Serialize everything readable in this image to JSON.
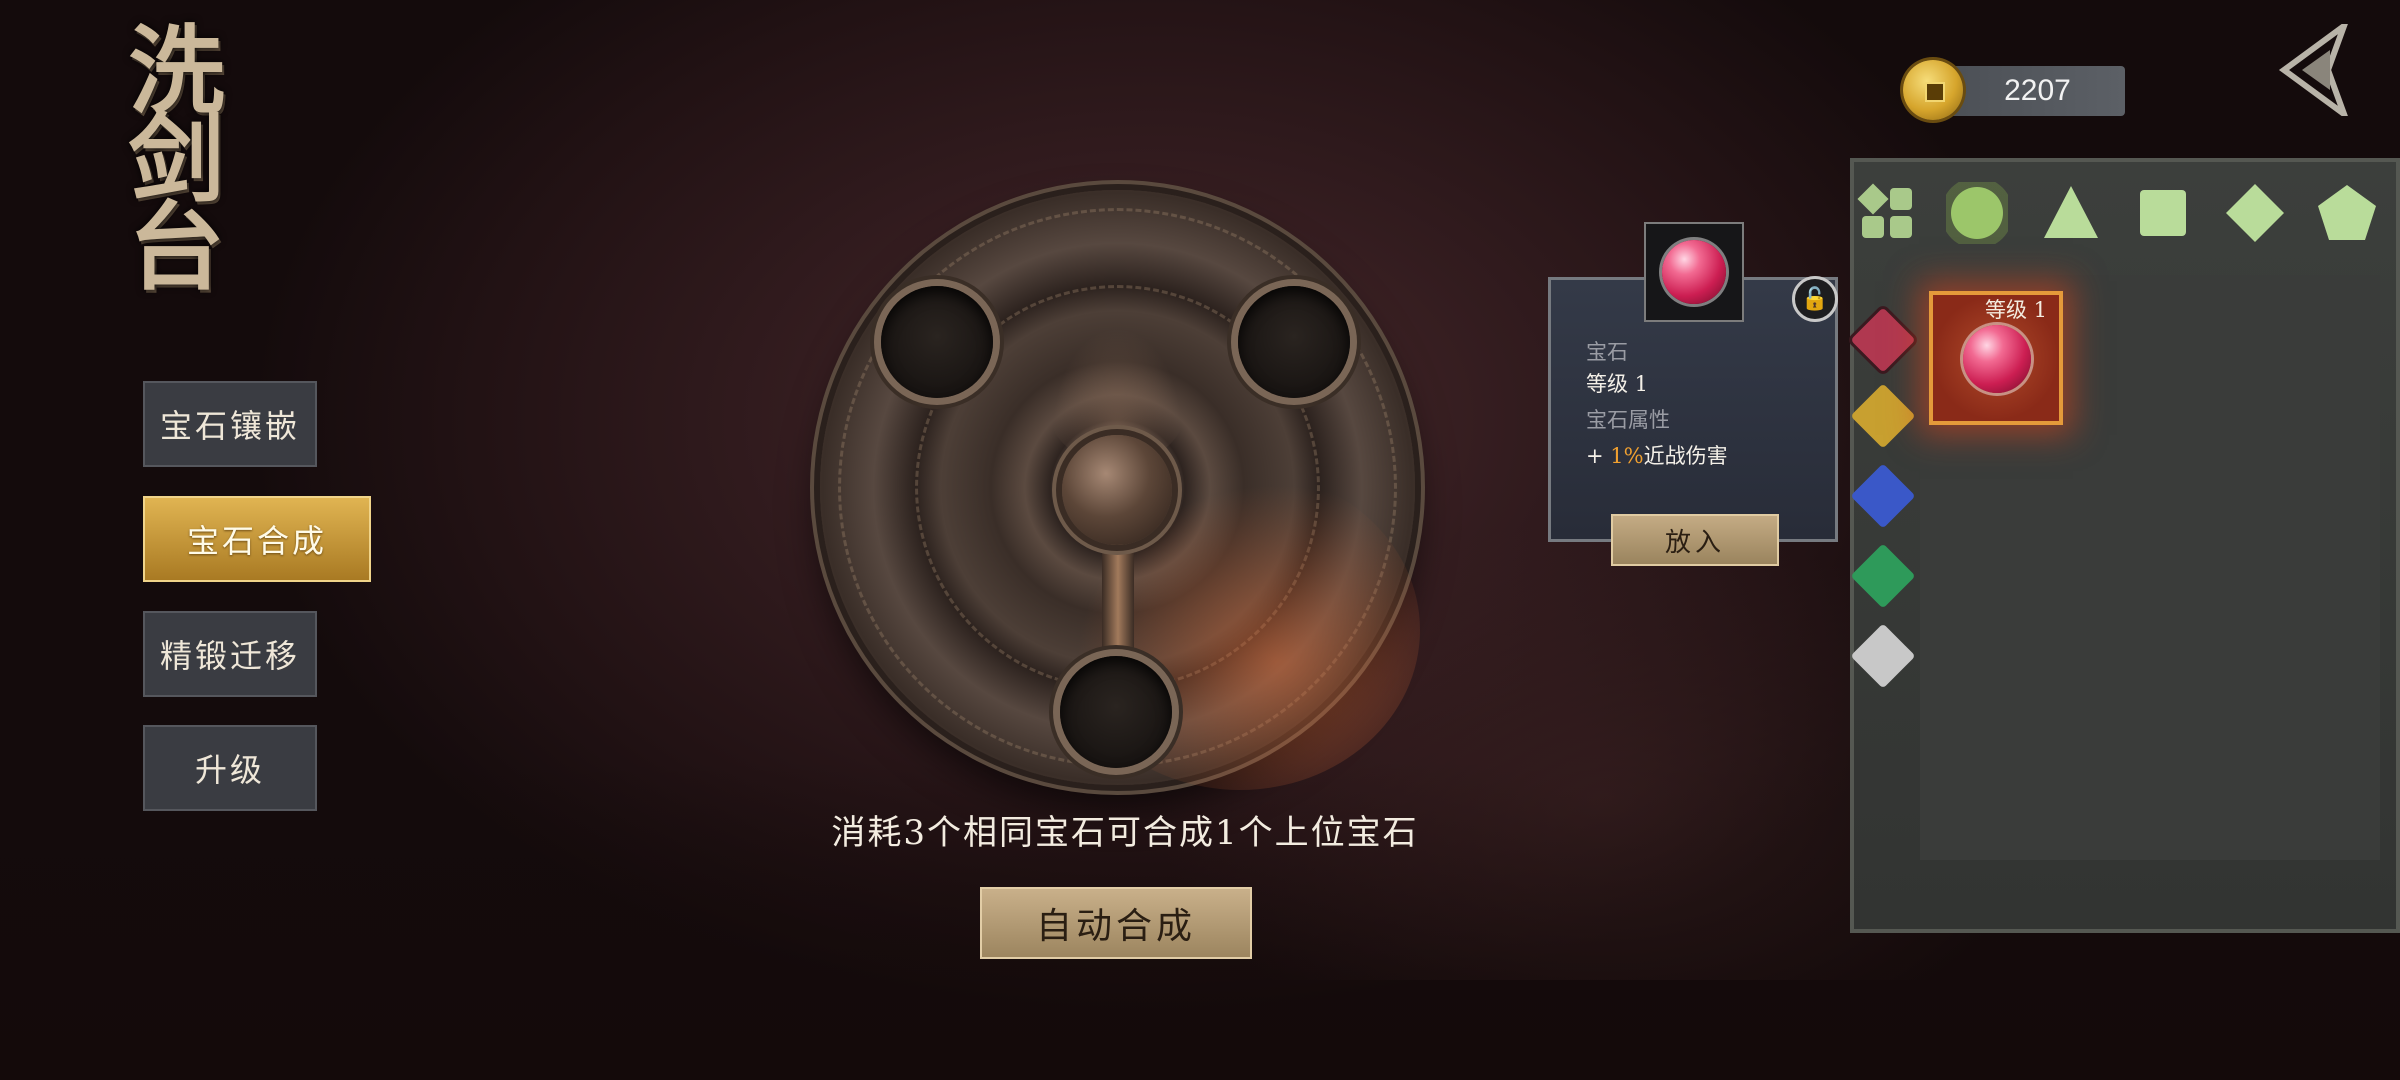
{
  "page": {
    "title": "洗剑台"
  },
  "menu": {
    "items": [
      {
        "label": "宝石镶嵌",
        "active": false
      },
      {
        "label": "宝石合成",
        "active": true
      },
      {
        "label": "精锻迁移",
        "active": false
      },
      {
        "label": "升级",
        "active": false
      }
    ]
  },
  "combine": {
    "info": "消耗3个相同宝石可合成1个上位宝石",
    "auto_button": "自动合成"
  },
  "currency": {
    "icon": "gold-coin-icon",
    "amount": "2207"
  },
  "inventory": {
    "shape_tabs": [
      "grid-icon",
      "circle-icon",
      "triangle-icon",
      "square-icon",
      "diamond-icon",
      "pentagon-icon"
    ],
    "selected_shape": "circle-icon",
    "color_tabs": [
      {
        "name": "red-gem-tab",
        "color": "#b03850"
      },
      {
        "name": "yellow-gem-tab",
        "color": "#c8a030"
      },
      {
        "name": "blue-gem-tab",
        "color": "#3a58c8"
      },
      {
        "name": "green-gem-tab",
        "color": "#2e9a5a"
      },
      {
        "name": "white-gem-tab",
        "color": "#c8c8c8"
      }
    ],
    "slot": {
      "level_label": "等级 1"
    }
  },
  "tooltip": {
    "type_label": "宝石",
    "level_label": "等级 1",
    "attr_label": "宝石属性",
    "bonus_prefix": "+ ",
    "bonus_value": "1%",
    "bonus_text": "近战伤害",
    "put_button": "放入"
  },
  "colors": {
    "accent_gold": "#e0b452",
    "highlight_orange": "#f0a030",
    "gem_red": "#cc1e52"
  }
}
